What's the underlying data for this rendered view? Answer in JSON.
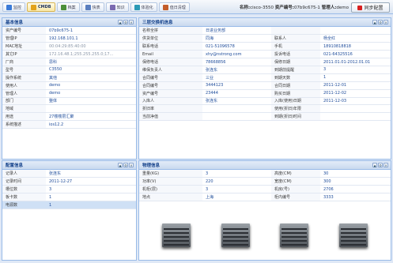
{
  "toolbar": {
    "tabs": [
      {
        "label": "监控",
        "icon": "monitor-icon",
        "active": false
      },
      {
        "label": "CMDB",
        "icon": "cmdb-icon",
        "active": true
      },
      {
        "label": "档案",
        "icon": "archive-icon",
        "active": false
      },
      {
        "label": "快表",
        "icon": "quick-table-icon",
        "active": false
      },
      {
        "label": "知识",
        "icon": "knowledge-icon",
        "active": false
      },
      {
        "label": "体验化",
        "icon": "experience-icon",
        "active": false
      },
      {
        "label": "值日清理",
        "icon": "duty-icon",
        "active": false
      }
    ],
    "name_label": "名称:",
    "name_value": "cisco-3550",
    "asset_label": "资产编号:",
    "asset_value": "07b9c675-1",
    "admin_label": "管理人:",
    "admin_value": "demo",
    "sync_label": "同步配置"
  },
  "basic": {
    "title": "基本信息",
    "rows": [
      {
        "k": "资产编号",
        "v": "07b9c675-1"
      },
      {
        "k": "管理IP",
        "v": "192.168.101.1"
      },
      {
        "k": "MAC地址",
        "v": "00:04:29:85:40:00",
        "dis": true
      },
      {
        "k": "其它IP",
        "v": "172.16.48.1;255.255.255.0;17...",
        "dis": true
      },
      {
        "k": "厂商",
        "v": "思科"
      },
      {
        "k": "型号",
        "v": "C3550"
      },
      {
        "k": "操作系统",
        "v": "其他"
      },
      {
        "k": "使用人",
        "v": "demo"
      },
      {
        "k": "管理人",
        "v": "demo"
      },
      {
        "k": "部门",
        "v": "整体"
      },
      {
        "k": "地域",
        "v": ""
      },
      {
        "k": "用途",
        "v": "27楼楼层汇聚"
      },
      {
        "k": "系统描述",
        "v": "ios12.2"
      }
    ]
  },
  "config": {
    "title": "配置信息",
    "rows": [
      {
        "k": "记录人",
        "v": "张连东"
      },
      {
        "k": "记录时间",
        "v": "2011-12-27"
      },
      {
        "k": "槽位数",
        "v": "3"
      },
      {
        "k": "板卡数",
        "v": "1"
      },
      {
        "k": "电源数",
        "v": "1",
        "sel": true
      }
    ]
  },
  "switch": {
    "title": "三层交换机信息",
    "rows": [
      [
        "名称全拼",
        "日进业务部",
        "",
        ""
      ],
      [
        "供货单位",
        "同海",
        "联系人",
        "杨全红"
      ],
      [
        "联系电话",
        "021-51096578",
        "手机",
        "18910818818"
      ],
      [
        "Email",
        "xhy@nstrong.com",
        "投诉电话",
        "021-64325516"
      ],
      [
        "保修电话",
        "78668856",
        "保修日期",
        "2011.01.01-2012.01.01"
      ],
      [
        "维保负责人",
        "张连东",
        "到期前提醒",
        "3"
      ],
      [
        "合同编号",
        "三业",
        "到期天数",
        "1"
      ],
      [
        "合同编号",
        "3444123",
        "合同日期",
        "2011-12-01"
      ],
      [
        "资产编号",
        "23444",
        "购买日期",
        "2011-12-02"
      ],
      [
        "入库人",
        "张连东",
        "入库(使用)日期",
        "2011-12-03"
      ],
      [
        "折旧率",
        "",
        "使用(折旧)年限",
        ""
      ],
      [
        "当前净值",
        "",
        "到期(折旧)时间",
        ""
      ]
    ]
  },
  "physical": {
    "title": "物理信息",
    "rows": [
      [
        "重量(KG)",
        "3",
        "高度(CM)",
        "30"
      ],
      [
        "功率(V)",
        "220",
        "宽度(CM)",
        "300"
      ],
      [
        "机柜(层)",
        "3",
        "机房(号)",
        "2706"
      ],
      [
        "地点",
        "上海",
        "柜内编号",
        "3333"
      ]
    ],
    "images": [
      "device-image-1",
      "device-image-2",
      "device-image-3",
      "device-image-4"
    ]
  },
  "panel_tools": [
    "▲",
    "⚙",
    "✕"
  ],
  "colors": {
    "accent": "#15428b",
    "border": "#99bbe8",
    "value": "#1e4c9b"
  }
}
